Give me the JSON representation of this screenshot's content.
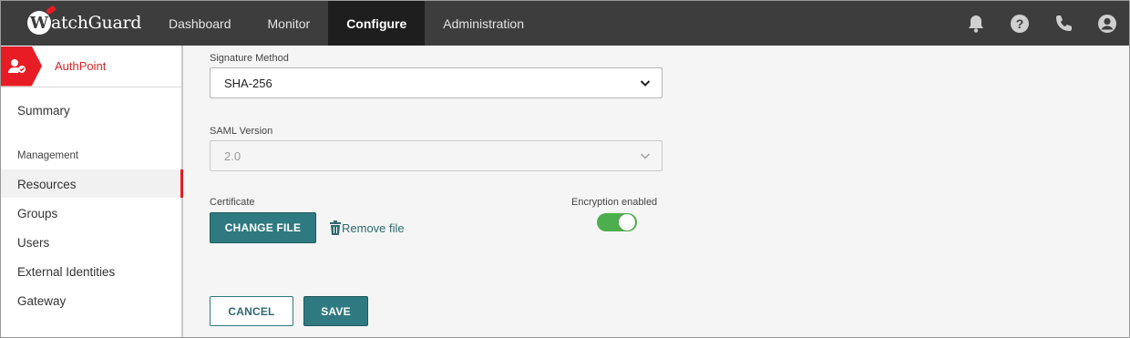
{
  "brand": {
    "logo_text": "atchGuard",
    "logo_initial": "W"
  },
  "nav": {
    "items": [
      "Dashboard",
      "Monitor",
      "Configure",
      "Administration"
    ],
    "active": "Configure"
  },
  "top_icons": [
    "bell-icon",
    "help-icon",
    "phone-icon",
    "user-icon"
  ],
  "sidebar": {
    "app_name": "AuthPoint",
    "summary": "Summary",
    "section": "Management",
    "items": [
      "Resources",
      "Groups",
      "Users",
      "External Identities",
      "Gateway"
    ],
    "active": "Resources"
  },
  "form": {
    "signature_method": {
      "label": "Signature Method",
      "value": "SHA-256"
    },
    "saml_version": {
      "label": "SAML Version",
      "value": "2.0",
      "disabled": true
    },
    "certificate": {
      "label": "Certificate",
      "change_button": "CHANGE FILE",
      "remove_link": "Remove file"
    },
    "encryption": {
      "label": "Encryption enabled",
      "enabled": true
    }
  },
  "actions": {
    "cancel": "CANCEL",
    "save": "SAVE"
  },
  "colors": {
    "brand_red": "#e81c24",
    "teal": "#2f7a80",
    "toggle_on": "#4cae4c",
    "topbar": "#3d3d3d"
  }
}
